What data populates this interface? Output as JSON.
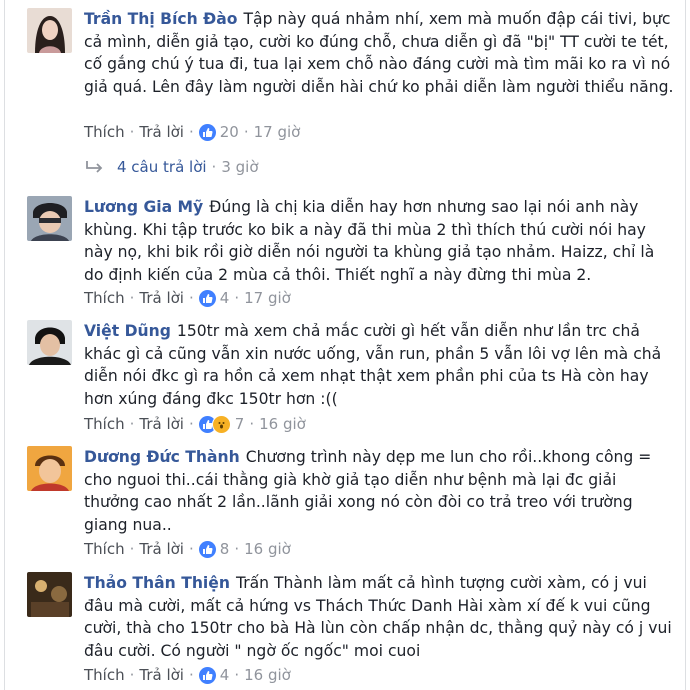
{
  "comments": [
    {
      "author": "Trần Thị Bích Đào",
      "text": "Tập này quá nhảm nhí, xem mà muốn đập cái tivi, bực cả mình, diễn giả tạo, cười ko đúng chỗ, chưa diễn gì đã \"bị\" TT cười te tét, cố gắng chú ý tua đi, tua lại xem chỗ nào đáng cười mà tìm mãi ko ra vì nó giả quá. Lên đây làm người diễn hài chứ ko phải diễn làm người thiểu năng.",
      "like_label": "Thích",
      "reply_label": "Trả lời",
      "reaction_count": "20",
      "time": "17 giờ",
      "reactions": [
        "like-icon"
      ]
    },
    {
      "author": "Lương Gia Mỹ",
      "text": "Đúng là chị kia diễn hay hơn nhưng sao lại nói anh này khùng. Khi tập trước ko bik a này đã thi mùa 2 thì thích thú cười nói hay này nọ, khi bik rồi giờ diễn nói người ta khùng giả tạo nhảm. Haizz, chỉ là do định kiến của 2 mùa cả thôi. Thiết nghĩ a này đừng thi mùa 2.",
      "like_label": "Thích",
      "reply_label": "Trả lời",
      "reaction_count": "4",
      "time": "17 giờ",
      "reactions": [
        "like-icon"
      ]
    },
    {
      "author": "Việt Dũng",
      "text": "150tr mà xem chả mắc cười gì hết vẫn diễn như lần trc chả khác gì cả cũng vẫn xin nước uống, vẫn run, phần 5 vẫn lôi vợ lên mà chả diễn nói đkc gì ra hồn cả xem nhạt thật xem phần phi của ts Hà còn hay hơn xúng đáng đkc 150tr hơn :((",
      "like_label": "Thích",
      "reply_label": "Trả lời",
      "reaction_count": "7",
      "time": "16 giờ",
      "reactions": [
        "like-icon",
        "wow-icon"
      ]
    },
    {
      "author": "Dương Đức Thành",
      "text": "Chương trình này dẹp me lun cho rồi..khong công = cho nguoi thi..cái thằng già khờ giả tạo diễn như bệnh mà lại đc giải thưởng cao nhất 2 lần..lãnh giải xong nó còn đòi co trả treo với trường giang nua..",
      "like_label": "Thích",
      "reply_label": "Trả lời",
      "reaction_count": "8",
      "time": "16 giờ",
      "reactions": [
        "like-icon"
      ]
    },
    {
      "author": "Thảo Thân Thiện",
      "text": "Trấn Thành làm mất cả hình tượng cười xàm, có j vui đâu mà cười, mất cả hứng vs Thách Thức Danh Hài xàm xí đế k vui cũng cười, thà cho 150tr cho bà Hà lùn còn chấp nhận dc, thằng quỷ này có j vui đâu cười. Có người \" ngờ ốc ngốc\" moi cuoi",
      "like_label": "Thích",
      "reply_label": "Trả lời",
      "reaction_count": "4",
      "time": "16 giờ",
      "reactions": [
        "like-icon"
      ]
    }
  ],
  "replies_link": {
    "label": "4 câu trả lời",
    "time": "3 giờ"
  },
  "separator": "·",
  "colors": {
    "author": "#365899",
    "text": "#1d2129",
    "meta": "#90949c",
    "like_badge": "#4080ff"
  }
}
